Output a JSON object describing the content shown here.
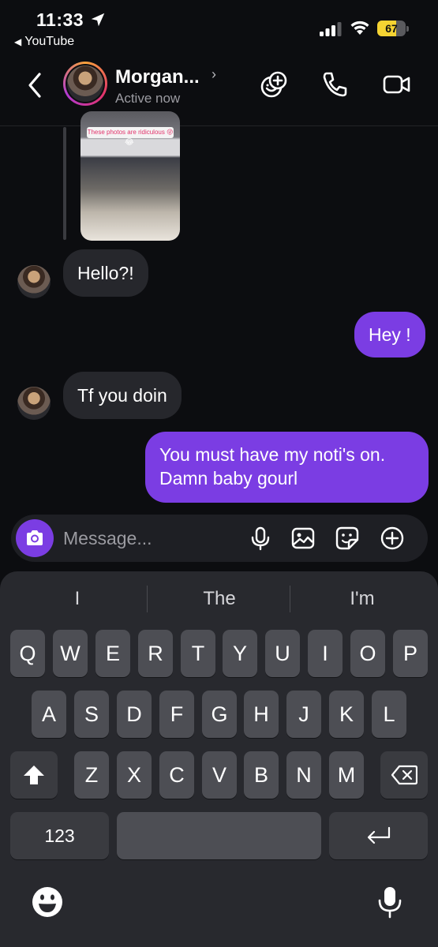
{
  "status_bar": {
    "time": "11:33",
    "back_app": "YouTube",
    "battery_level": 67,
    "battery_label": "67"
  },
  "header": {
    "contact_name": "Morgan...",
    "contact_status": "Active now",
    "icons": [
      "back-chevron-icon",
      "effects-icon",
      "phone-icon",
      "video-icon"
    ]
  },
  "chat": {
    "shared_photo_caption": "These photos are ridiculous 😜",
    "shared_photo_emoji": "😂",
    "messages": [
      {
        "sender": "contact",
        "text": "Hello?!"
      },
      {
        "sender": "me",
        "text": "Hey !"
      },
      {
        "sender": "contact",
        "text": "Tf you doin"
      },
      {
        "sender": "me",
        "text_line1": "You must have my noti's on.",
        "text_line2": "Damn baby gourl"
      }
    ]
  },
  "composer": {
    "placeholder": "Message...",
    "icons": [
      "camera-icon",
      "microphone-icon",
      "gallery-icon",
      "sticker-icon",
      "plus-icon"
    ]
  },
  "keyboard": {
    "suggestions": [
      "I",
      "The",
      "I'm"
    ],
    "row1": [
      "Q",
      "W",
      "E",
      "R",
      "T",
      "Y",
      "U",
      "I",
      "O",
      "P"
    ],
    "row2": [
      "A",
      "S",
      "D",
      "F",
      "G",
      "H",
      "J",
      "K",
      "L"
    ],
    "row3": [
      "Z",
      "X",
      "C",
      "V",
      "B",
      "N",
      "M"
    ],
    "numbers_key": "123",
    "colors": {
      "background": "#28292e",
      "key": "#4d4e54",
      "accent": "#7b3de3"
    }
  }
}
